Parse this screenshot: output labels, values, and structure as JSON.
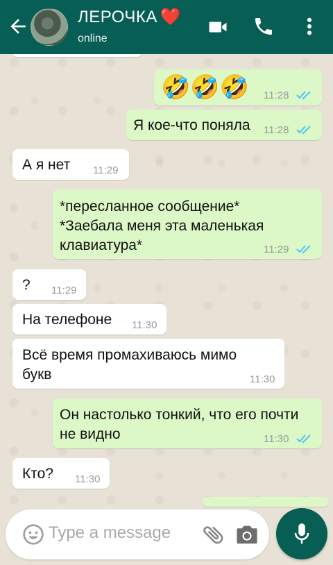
{
  "header": {
    "contact_name": "ЛЕРОЧКА",
    "heart": "❤️",
    "status": "online",
    "back_icon": "arrow-back-icon",
    "video_icon": "video-call-icon",
    "call_icon": "phone-icon",
    "more_icon": "more-vert-icon"
  },
  "colors": {
    "header_bg": "#075e54",
    "outgoing_bubble": "#dcf8c6",
    "incoming_bubble": "#ffffff",
    "read_ticks": "#4fc3f7"
  },
  "messages": [
    {
      "direction": "out",
      "text": "🤣🤣🤣",
      "time": "11:28",
      "read": true
    },
    {
      "direction": "out",
      "text": "Я кое-что поняла",
      "time": "11:28",
      "read": true
    },
    {
      "direction": "in",
      "text": "А я нет",
      "time": "11:29"
    },
    {
      "direction": "out",
      "text": "*пересланное сообщение*\n*Заебала меня эта маленькая клавиатура*",
      "time": "11:29",
      "read": true
    },
    {
      "direction": "in",
      "text": "?",
      "time": "11:29"
    },
    {
      "direction": "in",
      "text": "На телефоне",
      "time": "11:30"
    },
    {
      "direction": "in",
      "text": "Всё время промахиваюсь мимо букв",
      "time": "11:30"
    },
    {
      "direction": "out",
      "text": "Он настолько тонкий, что его почти не видно",
      "time": "11:30",
      "read": true
    },
    {
      "direction": "in",
      "text": "Кто?",
      "time": "11:30"
    }
  ],
  "composer": {
    "placeholder": "Type a message",
    "emoji_icon": "emoji-icon",
    "attach_icon": "paperclip-icon",
    "camera_icon": "camera-icon",
    "mic_icon": "microphone-icon"
  }
}
